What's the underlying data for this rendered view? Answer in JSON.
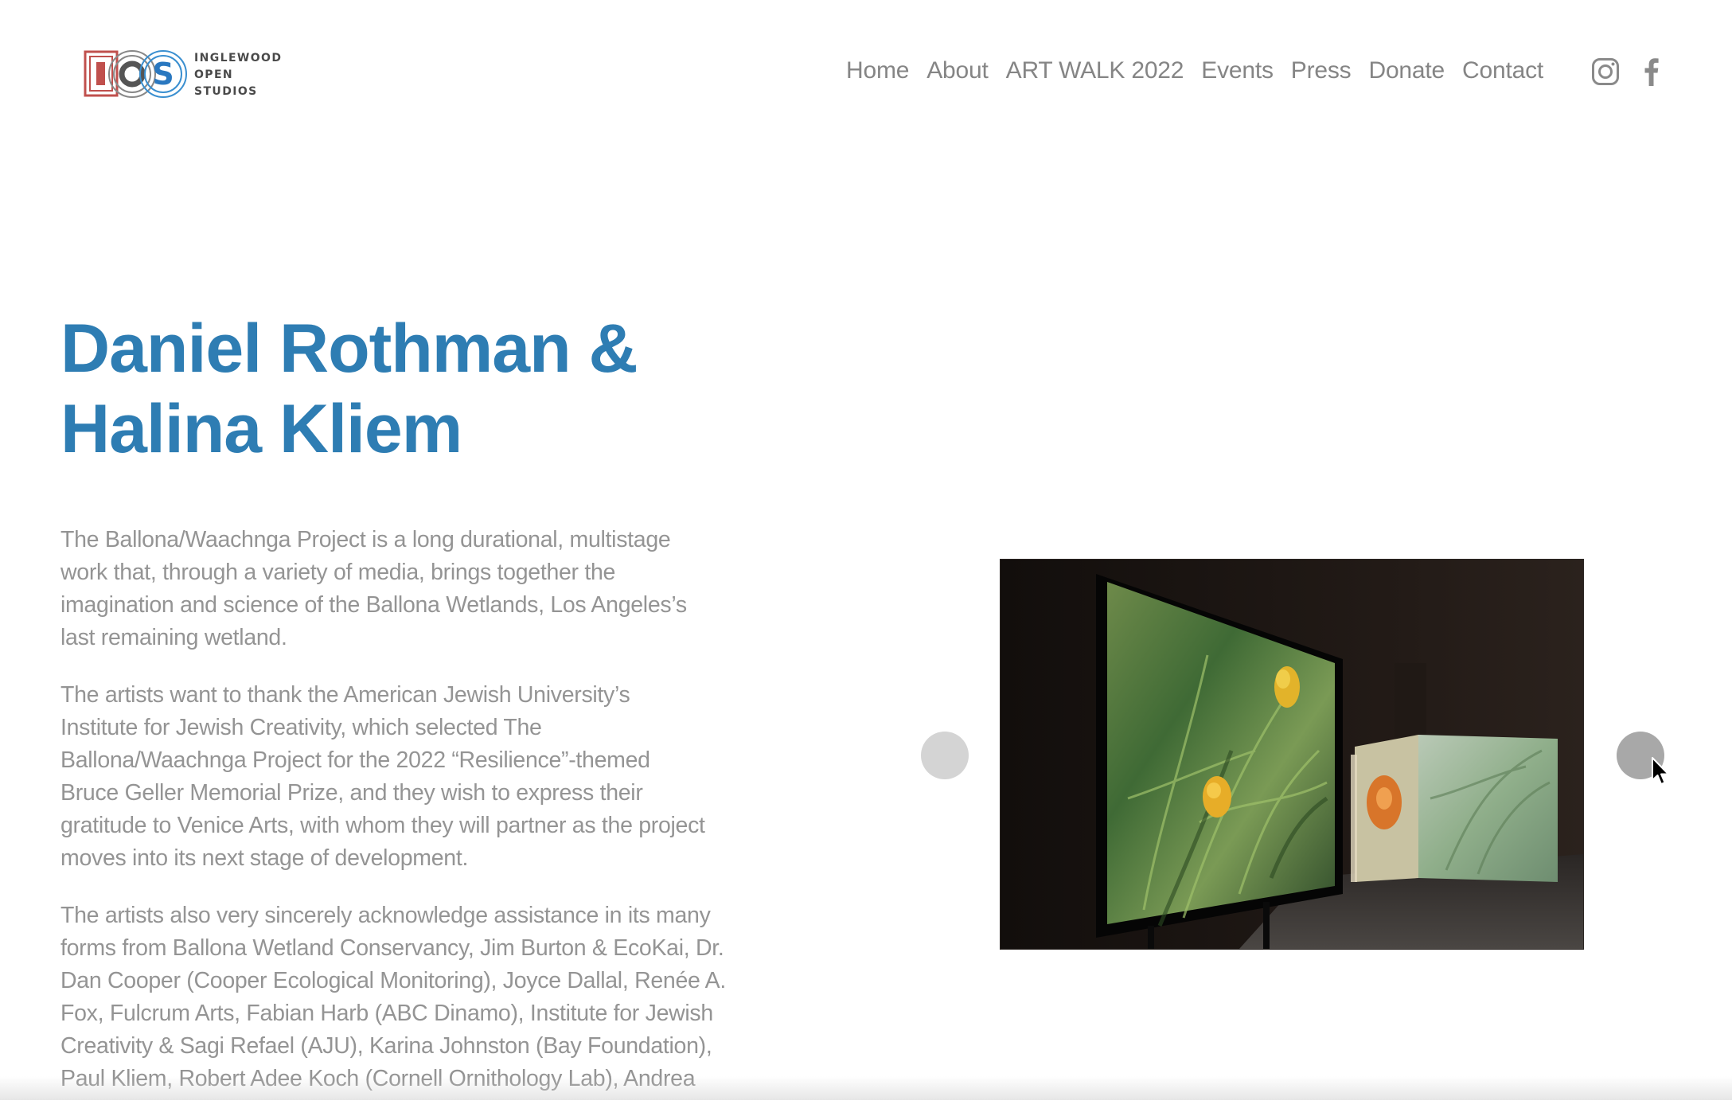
{
  "logo": {
    "letters": "IOS",
    "lines": [
      "INGLEWOOD",
      "OPEN",
      "STUDIOS"
    ]
  },
  "nav": {
    "items": [
      {
        "label": "Home"
      },
      {
        "label": "About"
      },
      {
        "label": "ART WALK 2022"
      },
      {
        "label": "Events"
      },
      {
        "label": "Press"
      },
      {
        "label": "Donate"
      },
      {
        "label": "Contact"
      }
    ],
    "social": [
      "instagram-icon",
      "facebook-icon"
    ]
  },
  "title": {
    "line1": "Daniel Rothman &",
    "line2": "Halina Kliem"
  },
  "paragraphs": [
    {
      "lines": [
        "The Ballona/Waachnga Project is a long durational, multistage",
        "work that, through a variety of media, brings together the",
        "imagination and science of the Ballona Wetlands, Los Angeles’s",
        "last remaining wetland."
      ]
    },
    {
      "lines": [
        "The artists want to thank the American Jewish University’s",
        "Institute for Jewish Creativity, which selected The",
        "Ballona/Waachnga Project for the 2022 “Resilience”-themed",
        "Bruce Geller Memorial Prize, and they wish to express their",
        "gratitude to Venice Arts, with whom they will partner as the project",
        "moves into its next stage of development."
      ]
    },
    {
      "lines": [
        "The artists also very sincerely acknowledge assistance in its many",
        "forms from Ballona Wetland Conservancy, Jim Burton & EcoKai, Dr.",
        "Dan Cooper (Cooper Ecological Monitoring), Joyce Dallal, Renée A.",
        "Fox, Fulcrum Arts, Fabian Harb (ABC Dinamo), Institute for Jewish",
        "Creativity & Sagi Refael (AJU), Karina Johnston (Bay Foundation),",
        "Paul Kliem, Robert Adee Koch (Cornell Ornithology Lab), Andrea"
      ]
    }
  ],
  "colors": {
    "title": "#2e7db3",
    "body_text": "#949494",
    "nav_text": "#858585"
  }
}
